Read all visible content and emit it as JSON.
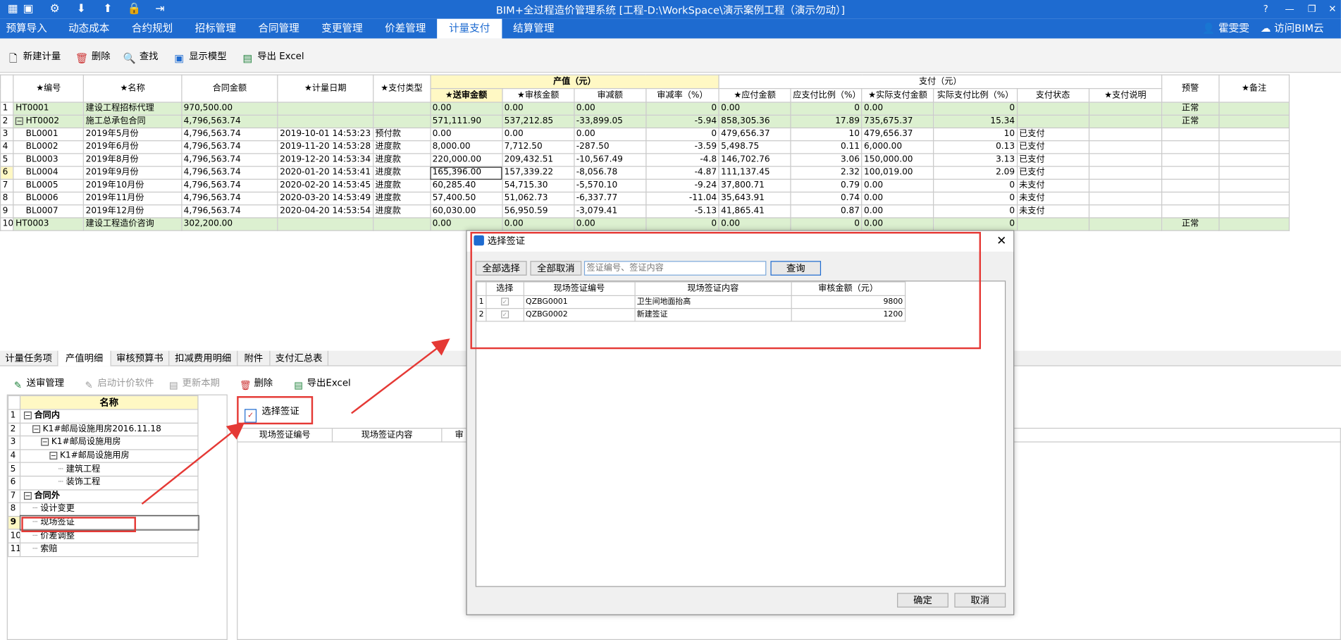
{
  "app": {
    "title": "BIM+全过程造价管理系统 [工程-D:\\WorkSpace\\演示案例工程（演示勿动）]"
  },
  "menu": [
    "预算导入",
    "动态成本",
    "合约规划",
    "招标管理",
    "合同管理",
    "变更管理",
    "价差管理",
    "计量支付",
    "结算管理"
  ],
  "active_menu": "计量支付",
  "user": {
    "name": "霍雯雯",
    "cloud": "访问BIM云"
  },
  "toolbar": {
    "new": "新建计量",
    "delete": "删除",
    "find": "查找",
    "model": "显示模型",
    "export": "导出 Excel"
  },
  "grid": {
    "group_output": "产值（元）",
    "group_pay": "支付（元）",
    "headers": [
      "★编号",
      "★名称",
      "合同金额",
      "★计量日期",
      "★支付类型",
      "★送审金额",
      "★审核金额",
      "审减额",
      "审减率（%）",
      "★应付金额",
      "应支付比例（%）",
      "★实际支付金额",
      "实际支付比例（%）",
      "支付状态",
      "★支付说明",
      "预警",
      "★备注"
    ],
    "rows": [
      [
        "1",
        "HT0001",
        "建设工程招标代理",
        "970,500.00",
        "",
        "",
        "0.00",
        "0.00",
        "0.00",
        "0",
        "0.00",
        "0",
        "0.00",
        "0",
        "",
        "",
        "正常",
        ""
      ],
      [
        "2",
        "HT0002",
        "施工总承包合同",
        "4,796,563.74",
        "",
        "",
        "571,111.90",
        "537,212.85",
        "-33,899.05",
        "-5.94",
        "858,305.36",
        "17.89",
        "735,675.37",
        "15.34",
        "",
        "",
        "正常",
        ""
      ],
      [
        "3",
        "BL0001",
        "2019年5月份",
        "4,796,563.74",
        "2019-10-01 14:53:23",
        "预付款",
        "0.00",
        "0.00",
        "0.00",
        "0",
        "479,656.37",
        "10",
        "479,656.37",
        "10",
        "已支付",
        "",
        "",
        ""
      ],
      [
        "4",
        "BL0002",
        "2019年6月份",
        "4,796,563.74",
        "2019-11-20 14:53:28",
        "进度款",
        "8,000.00",
        "7,712.50",
        "-287.50",
        "-3.59",
        "5,498.75",
        "0.11",
        "6,000.00",
        "0.13",
        "已支付",
        "",
        "",
        ""
      ],
      [
        "5",
        "BL0003",
        "2019年8月份",
        "4,796,563.74",
        "2019-12-20 14:53:34",
        "进度款",
        "220,000.00",
        "209,432.51",
        "-10,567.49",
        "-4.8",
        "146,702.76",
        "3.06",
        "150,000.00",
        "3.13",
        "已支付",
        "",
        "",
        ""
      ],
      [
        "6",
        "BL0004",
        "2019年9月份",
        "4,796,563.74",
        "2020-01-20 14:53:41",
        "进度款",
        "165,396.00",
        "157,339.22",
        "-8,056.78",
        "-4.87",
        "111,137.45",
        "2.32",
        "100,019.00",
        "2.09",
        "已支付",
        "",
        "",
        ""
      ],
      [
        "7",
        "BL0005",
        "2019年10月份",
        "4,796,563.74",
        "2020-02-20 14:53:45",
        "进度款",
        "60,285.40",
        "54,715.30",
        "-5,570.10",
        "-9.24",
        "37,800.71",
        "0.79",
        "0.00",
        "0",
        "未支付",
        "",
        "",
        ""
      ],
      [
        "8",
        "BL0006",
        "2019年11月份",
        "4,796,563.74",
        "2020-03-20 14:53:49",
        "进度款",
        "57,400.50",
        "51,062.73",
        "-6,337.77",
        "-11.04",
        "35,643.91",
        "0.74",
        "0.00",
        "0",
        "未支付",
        "",
        "",
        ""
      ],
      [
        "9",
        "BL0007",
        "2019年12月份",
        "4,796,563.74",
        "2020-04-20 14:53:54",
        "进度款",
        "60,030.00",
        "56,950.59",
        "-3,079.41",
        "-5.13",
        "41,865.41",
        "0.87",
        "0.00",
        "0",
        "未支付",
        "",
        "",
        ""
      ],
      [
        "10",
        "HT0003",
        "建设工程造价咨询",
        "302,200.00",
        "",
        "",
        "0.00",
        "0.00",
        "0.00",
        "0",
        "0.00",
        "0",
        "0.00",
        "0",
        "",
        "",
        "正常",
        ""
      ]
    ]
  },
  "bottom_tabs": [
    "计量任务项",
    "产值明细",
    "审核预算书",
    "扣减费用明细",
    "附件",
    "支付汇总表"
  ],
  "bottom_toolbar": {
    "review": "送审管理",
    "start": "启动计价软件",
    "update": "更新本期",
    "delete": "删除",
    "export": "导出Excel"
  },
  "tree": {
    "header": "名称",
    "rows": [
      {
        "n": "1",
        "label": "合同内",
        "bold": true,
        "indent": 0,
        "box": "−"
      },
      {
        "n": "2",
        "label": "K1#邮局设施用房2016.11.18",
        "indent": 1,
        "box": "−"
      },
      {
        "n": "3",
        "label": "K1#邮局设施用房",
        "indent": 2,
        "box": "−"
      },
      {
        "n": "4",
        "label": "K1#邮局设施用房",
        "indent": 3,
        "box": "−"
      },
      {
        "n": "5",
        "label": "建筑工程",
        "indent": 4,
        "box": ""
      },
      {
        "n": "6",
        "label": "装饰工程",
        "indent": 4,
        "box": ""
      },
      {
        "n": "7",
        "label": "合同外",
        "bold": true,
        "indent": 0,
        "box": "−"
      },
      {
        "n": "8",
        "label": "设计变更",
        "indent": 1,
        "box": ""
      },
      {
        "n": "9",
        "label": "现场签证",
        "indent": 1,
        "box": "",
        "selected": true
      },
      {
        "n": "10",
        "label": "价差调整",
        "indent": 1,
        "box": ""
      },
      {
        "n": "11",
        "label": "索赔",
        "indent": 1,
        "box": ""
      }
    ]
  },
  "visa_panel": {
    "button": "选择签证",
    "col1": "现场签证编号",
    "col2": "现场签证内容",
    "col3": "审"
  },
  "dialog": {
    "title": "选择签证",
    "select_all": "全部选择",
    "deselect_all": "全部取消",
    "search_placeholder": "签证编号、签证内容",
    "query": "查询",
    "headers": [
      "选择",
      "现场签证编号",
      "现场签证内容",
      "审核金额（元）"
    ],
    "rows": [
      {
        "n": "1",
        "code": "QZBG0001",
        "content": "卫生间地面抬高",
        "amount": "9800"
      },
      {
        "n": "2",
        "code": "QZBG0002",
        "content": "新建签证",
        "amount": "1200"
      }
    ],
    "ok": "确定",
    "cancel": "取消"
  },
  "colors": {
    "brand": "#1e6bd0",
    "highlight": "#e53935",
    "green_row": "#dcf0d0",
    "yellow_header": "#fff8c4"
  }
}
